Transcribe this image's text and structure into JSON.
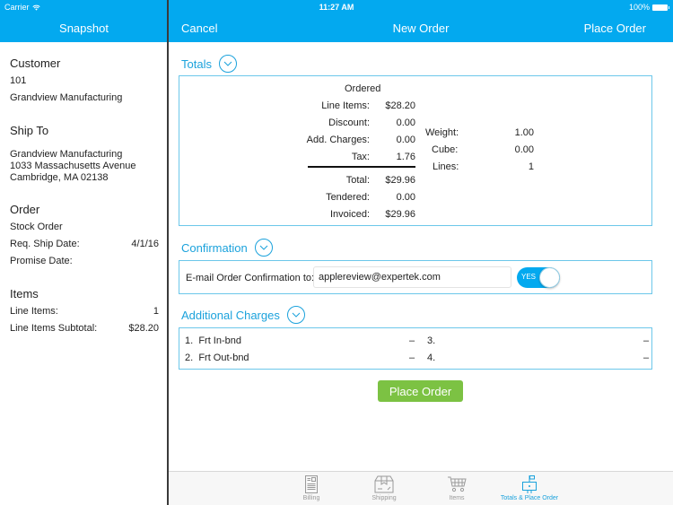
{
  "status_bar": {
    "carrier": "Carrier",
    "time": "11:27 AM",
    "battery": "100%"
  },
  "nav": {
    "left_title": "Snapshot",
    "cancel": "Cancel",
    "title": "New Order",
    "place_order": "Place Order"
  },
  "sidebar": {
    "customer": {
      "heading": "Customer",
      "number": "101",
      "name": "Grandview Manufacturing"
    },
    "ship_to": {
      "heading": "Ship To",
      "line1": "Grandview Manufacturing",
      "line2": "1033 Massachusetts Avenue",
      "line3": "Cambridge, MA 02138"
    },
    "order": {
      "heading": "Order",
      "type": "Stock Order",
      "req_ship_label": "Req. Ship Date:",
      "req_ship_value": "4/1/16",
      "promise_label": "Promise Date:",
      "promise_value": ""
    },
    "items": {
      "heading": "Items",
      "line_items_label": "Line Items:",
      "line_items_value": "1",
      "subtotal_label": "Line Items Subtotal:",
      "subtotal_value": "$28.20"
    }
  },
  "totals": {
    "title": "Totals",
    "column_header": "Ordered",
    "rows": [
      {
        "label": "Line Items:",
        "value": "$28.20"
      },
      {
        "label": "Discount:",
        "value": "0.00"
      },
      {
        "label": "Add. Charges:",
        "value": "0.00"
      },
      {
        "label": "Tax:",
        "value": "1.76"
      }
    ],
    "summary": [
      {
        "label": "Total:",
        "value": "$29.96"
      },
      {
        "label": "Tendered:",
        "value": "0.00"
      },
      {
        "label": "Invoiced:",
        "value": "$29.96"
      }
    ],
    "metrics": [
      {
        "label": "Weight:",
        "value": "1.00"
      },
      {
        "label": "Cube:",
        "value": "0.00"
      },
      {
        "label": "Lines:",
        "value": "1"
      }
    ]
  },
  "confirmation": {
    "title": "Confirmation",
    "label": "E-mail Order Confirmation to:",
    "email": "applereview@expertek.com",
    "toggle_label": "YES",
    "toggle_on": true
  },
  "additional_charges": {
    "title": "Additional Charges",
    "items": [
      {
        "num": "1.",
        "name": "Frt In-bnd",
        "value": "–"
      },
      {
        "num": "2.",
        "name": "Frt Out-bnd",
        "value": "–"
      },
      {
        "num": "3.",
        "name": "",
        "value": "–"
      },
      {
        "num": "4.",
        "name": "",
        "value": "–"
      }
    ]
  },
  "place_order_button": "Place Order",
  "tabs": [
    {
      "label": "Billing",
      "icon": "billing-document-icon",
      "active": false
    },
    {
      "label": "Shipping",
      "icon": "shipping-box-icon",
      "active": false
    },
    {
      "label": "Items",
      "icon": "shopping-cart-icon",
      "active": false
    },
    {
      "label": "Totals & Place Order",
      "icon": "mailbox-flag-icon",
      "active": true
    }
  ],
  "colors": {
    "brand_blue": "#03a9ef",
    "accent_text": "#1ba2dc",
    "panel_border": "#6cc7ea",
    "button_green": "#7cc243"
  }
}
